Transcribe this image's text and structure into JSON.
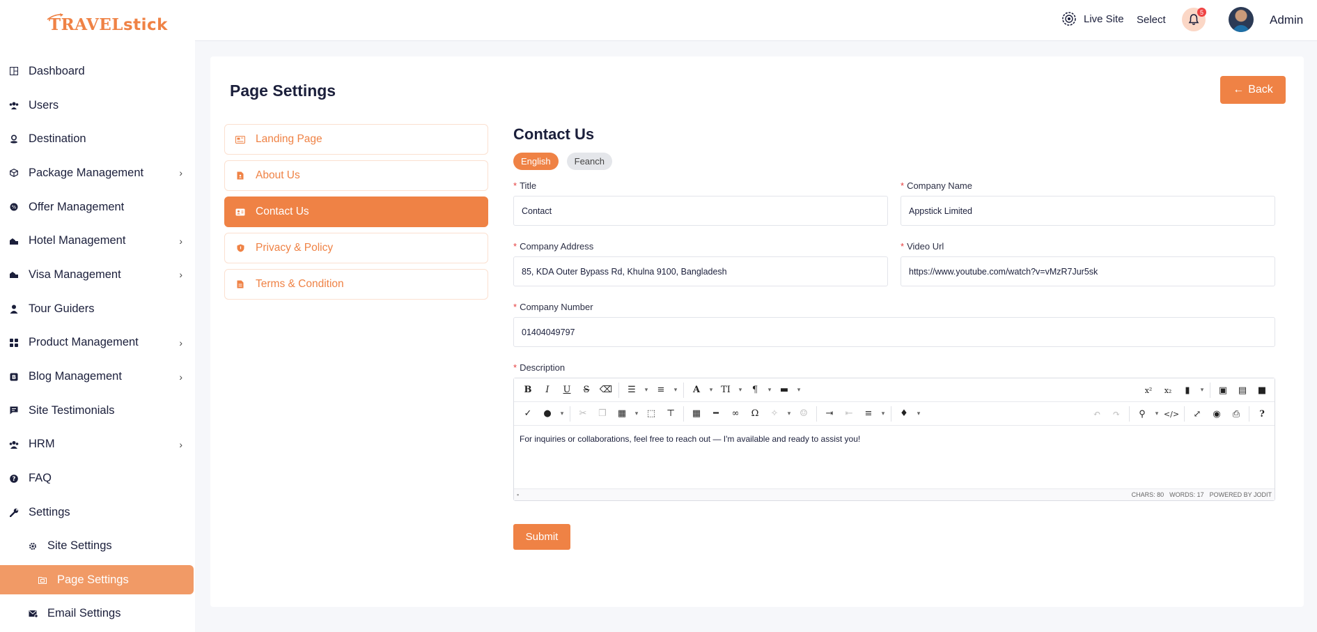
{
  "app": {
    "logo_text_1": "TRAVEL",
    "logo_text_2": "stick"
  },
  "header": {
    "live_site": "Live Site",
    "select": "Select",
    "notification_count": "5",
    "admin": "Admin"
  },
  "sidebar": {
    "items": [
      {
        "label": "Dashboard",
        "icon": "dashboard-icon",
        "has_submenu": false
      },
      {
        "label": "Users",
        "icon": "users-icon",
        "has_submenu": false
      },
      {
        "label": "Destination",
        "icon": "location-icon",
        "has_submenu": false
      },
      {
        "label": "Package Management",
        "icon": "package-icon",
        "has_submenu": true
      },
      {
        "label": "Offer Management",
        "icon": "offer-icon",
        "has_submenu": false
      },
      {
        "label": "Hotel Management",
        "icon": "hotel-icon",
        "has_submenu": true
      },
      {
        "label": "Visa Management",
        "icon": "visa-icon",
        "has_submenu": true
      },
      {
        "label": "Tour Guiders",
        "icon": "guide-icon",
        "has_submenu": false
      },
      {
        "label": "Product Management",
        "icon": "product-icon",
        "has_submenu": true
      },
      {
        "label": "Blog Management",
        "icon": "blog-icon",
        "has_submenu": true
      },
      {
        "label": "Site Testimonials",
        "icon": "testimonial-icon",
        "has_submenu": false
      },
      {
        "label": "HRM",
        "icon": "hrm-icon",
        "has_submenu": true
      },
      {
        "label": "FAQ",
        "icon": "faq-icon",
        "has_submenu": false
      },
      {
        "label": "Settings",
        "icon": "wrench-icon",
        "has_submenu": false
      }
    ],
    "sub_items": [
      {
        "label": "Site Settings",
        "icon": "gear-icon",
        "active": false
      },
      {
        "label": "Page Settings",
        "icon": "page-icon",
        "active": true
      },
      {
        "label": "Email Settings",
        "icon": "email-icon",
        "active": false
      }
    ]
  },
  "page": {
    "title": "Page Settings",
    "back_label": "Back"
  },
  "tabs": [
    {
      "label": "Landing Page",
      "active": false
    },
    {
      "label": "About Us",
      "active": false
    },
    {
      "label": "Contact Us",
      "active": true
    },
    {
      "label": "Privacy & Policy",
      "active": false
    },
    {
      "label": "Terms & Condition",
      "active": false
    }
  ],
  "form": {
    "title": "Contact Us",
    "languages": [
      {
        "label": "English",
        "active": true
      },
      {
        "label": "Feanch",
        "active": false
      }
    ],
    "fields": {
      "title": {
        "label": "Title",
        "value": "Contact"
      },
      "company_name": {
        "label": "Company Name",
        "value": "Appstick Limited"
      },
      "company_address": {
        "label": "Company Address",
        "value": "85, KDA Outer Bypass Rd, Khulna 9100, Bangladesh"
      },
      "video_url": {
        "label": "Video Url",
        "value": "https://www.youtube.com/watch?v=vMzR7Jur5sk"
      },
      "company_number": {
        "label": "Company Number",
        "value": "01404049797"
      },
      "description": {
        "label": "Description",
        "value": "For inquiries or collaborations, feel free to reach out — I'm available and ready to assist you!"
      }
    },
    "editor_status": {
      "chars": "CHARS: 80",
      "words": "WORDS: 17",
      "powered": "POWERED BY JODIT"
    },
    "submit_label": "Submit"
  },
  "colors": {
    "accent": "#ef8245",
    "active_sidebar": "#f19a66",
    "text": "#1b1f3b"
  }
}
